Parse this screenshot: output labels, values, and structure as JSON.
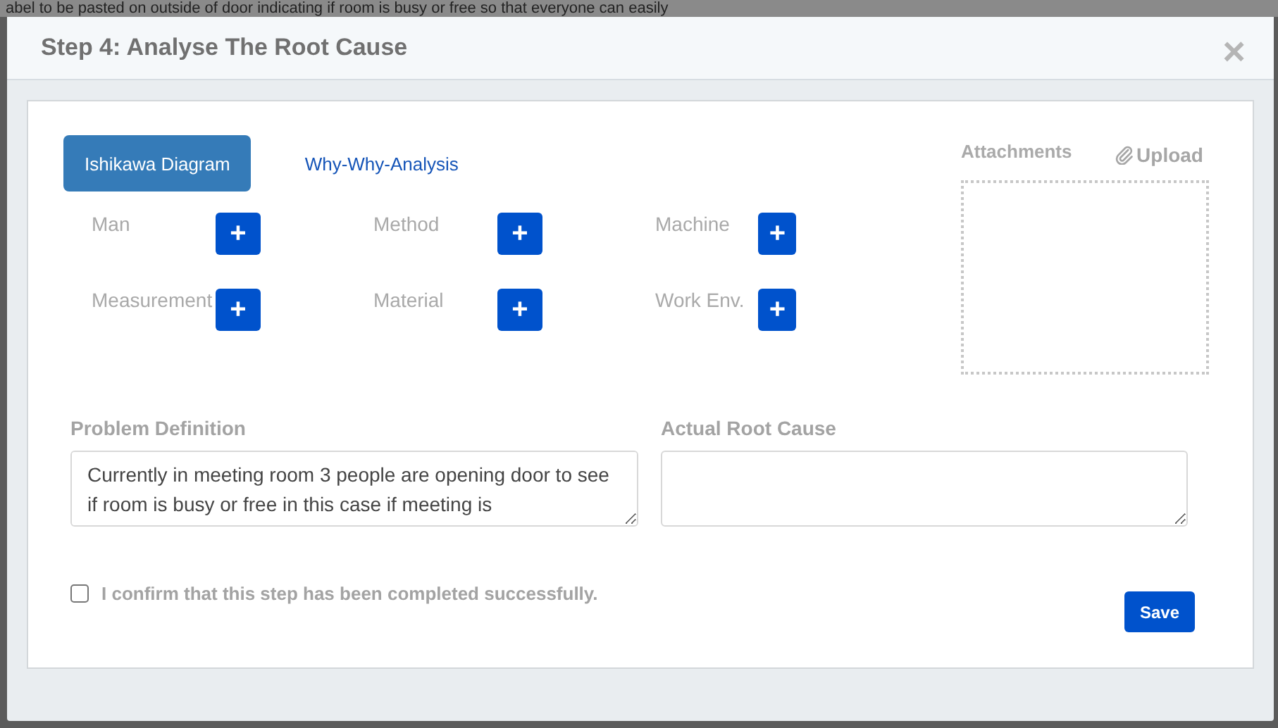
{
  "backdrop_text": "abel to be pasted on outside of door indicating if room is busy or free so that everyone can easily",
  "dialog": {
    "title": "Step 4: Analyse The Root Cause",
    "close": "×"
  },
  "tabs": [
    {
      "label": "Ishikawa Diagram",
      "selected": true
    },
    {
      "label": "Why-Why-Analysis",
      "selected": false
    }
  ],
  "categories": [
    {
      "label": "Man",
      "add": "+"
    },
    {
      "label": "Method",
      "add": "+"
    },
    {
      "label": "Machine",
      "add": "+"
    },
    {
      "label": "Measurement",
      "add": "+"
    },
    {
      "label": "Material",
      "add": "+"
    },
    {
      "label": "Work Env.",
      "add": "+"
    }
  ],
  "attachments": {
    "label": "Attachments",
    "upload": "Upload"
  },
  "problem_definition": {
    "label": "Problem Definition",
    "value": "Currently in meeting room 3 people are opening door to see if room is busy or free in this case if meeting is"
  },
  "actual_root_cause": {
    "label": "Actual Root Cause"
  },
  "confirm": {
    "label": "I confirm that this step has been completed successfully.",
    "checked": false
  },
  "save": "Save"
}
